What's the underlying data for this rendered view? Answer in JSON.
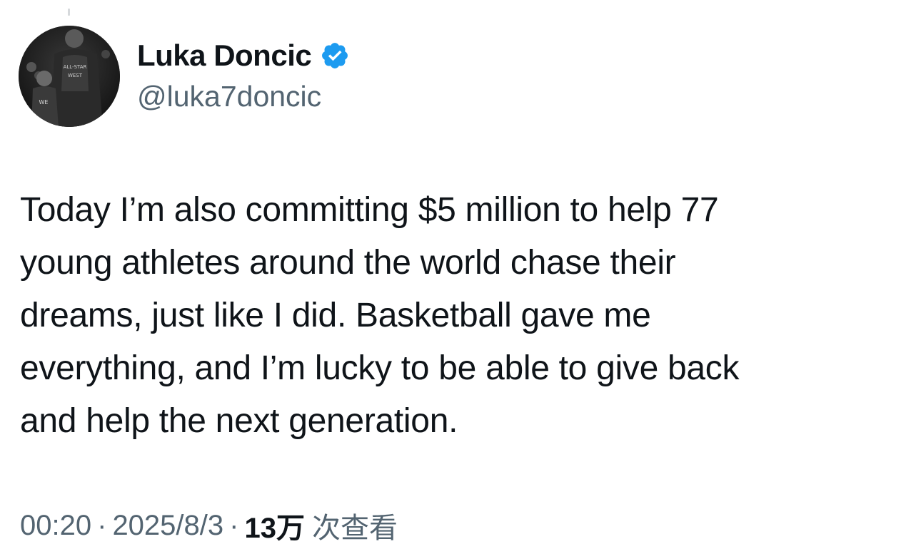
{
  "tweet": {
    "author": {
      "display_name": "Luka Doncic",
      "handle": "@luka7doncic",
      "verified": true,
      "avatar_icon": "avatar-photo",
      "verified_icon": "verified-badge-icon",
      "verified_color": "#1d9bf0"
    },
    "text_lines": [
      "Today I’m also committing $5 million to help 77",
      "young athletes around the world chase their",
      "dreams, just like I did. Basketball gave me",
      "everything, and I’m lucky to be able to give back",
      "and help the next generation."
    ],
    "meta": {
      "time": "00:20",
      "separator": "·",
      "date": "2025/8/3",
      "views_count": "13万",
      "views_label": "次查看"
    }
  }
}
